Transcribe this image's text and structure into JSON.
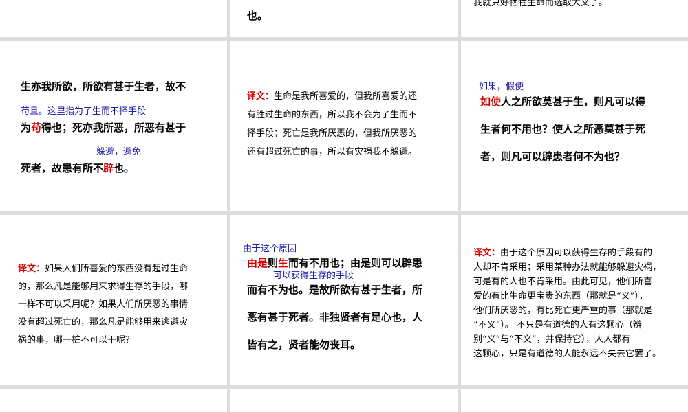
{
  "top_row": {
    "middle": "也。",
    "right": "我就只好牺牲生命而选取大义了。"
  },
  "row2": {
    "left": {
      "line1": "生亦我所欲，所欲有甚于生者，故不",
      "ann1": "苟且。这里指为了生而不择手段",
      "line2_a": "为",
      "line2_red": "苟",
      "line2_b": "得也；死亦我所恶，所恶有甚于",
      "ann2": "躲避，避免",
      "line3_a": "死者，故患有所不",
      "line3_red": "辟",
      "line3_b": "也。"
    },
    "middle": {
      "label": "译文：",
      "line1": "生命是我所喜爱的，但我所喜爱的还",
      "line2": "有胜过生命的东西，所以我不会为了生而不",
      "line3": "择手段；死亡是我所厌恶的，但我所厌恶的",
      "line4": "还有超过死亡的事，所以有灾祸我不躲避。"
    },
    "right": {
      "ann": "如果，假使",
      "line1_red": "如使",
      "line1_b": "人之所欲莫甚于生，则凡可以得",
      "line2": "生者何不用也？使人之所恶莫甚于死",
      "line3": "者，则凡可以辟患者何不为也？"
    }
  },
  "row3": {
    "left": {
      "label": "译文：",
      "line1": "如果人们所喜爱的东西没有超过生命",
      "line2": "的，那么凡是能够用来求得生存的手段，哪",
      "line3": "一样不可以采用呢？如果人们所厌恶的事情",
      "line4": "没有超过死亡的，那么凡是能够用来逃避灾",
      "line5": "祸的事，哪一桩不可以干呢？"
    },
    "middle": {
      "ann1": "由于这个原因",
      "line1_red1": "由是",
      "line1_b1": "则",
      "line1_red2": "生",
      "line1_b2": "而有不用也；由是则可以辟患",
      "ann2": "可以获得生存的手段",
      "line2": "而有不为也。是故所欲有甚于生者，所",
      "line3": "恶有甚于死者。非独贤者有是心也，人",
      "line4": "皆有之，贤者能勿丧耳。"
    },
    "right": {
      "label": "译文：",
      "line1": "由于这个原因可以获得生存的手段有的",
      "line2": "人却不肯采用；采用某种办法就能够躲避灾祸，",
      "line3": "可是有的人也不肯采用。由此可见，他们所喜",
      "line4": "爱的有比生命更宝贵的东西（那就是“义”），",
      "line5": "他们所厌恶的，有比死亡更严重的事（那就是",
      "line6": "“不义”）。 不只是有道德的人有这颗心（辨",
      "line7": "别“义”与“不义”，并保持它），人人都有",
      "line8": "这颗心，只是有道德的人能永远不失去它罢了。"
    }
  }
}
